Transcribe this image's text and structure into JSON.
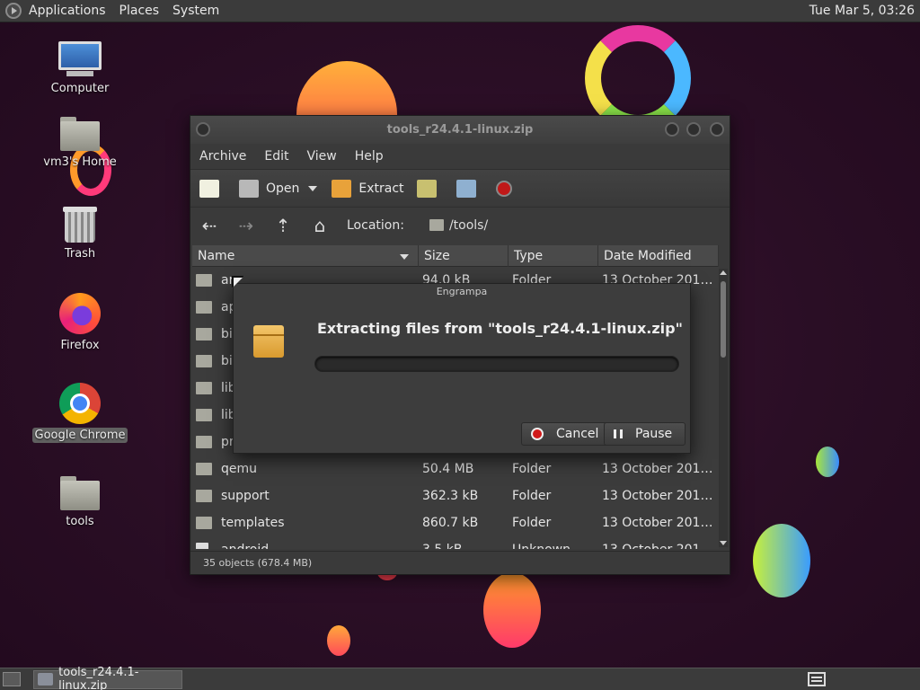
{
  "panel": {
    "menus": [
      "Applications",
      "Places",
      "System"
    ],
    "clock": "Tue Mar  5, 03:26"
  },
  "desktop": {
    "icons": [
      {
        "label": "Computer",
        "icon": "computer-icon"
      },
      {
        "label": "vm3's Home",
        "icon": "home-folder-icon"
      },
      {
        "label": "Trash",
        "icon": "trash-icon"
      },
      {
        "label": "Firefox",
        "icon": "firefox-icon"
      },
      {
        "label": "Google Chrome",
        "icon": "chrome-icon"
      },
      {
        "label": "tools",
        "icon": "folder-icon"
      }
    ]
  },
  "window": {
    "title": "tools_r24.4.1-linux.zip",
    "menu": [
      "Archive",
      "Edit",
      "View",
      "Help"
    ],
    "toolbar": {
      "open": "Open",
      "extract": "Extract"
    },
    "location_label": "Location:",
    "location": "/tools/",
    "columns": [
      "Name",
      "Size",
      "Type",
      "Date Modified"
    ],
    "rows": [
      {
        "name": "ar",
        "size": "94.0 kB",
        "type": "Folder",
        "date": "13 October 2015, 1..."
      },
      {
        "name": "ap",
        "size": "",
        "type": "",
        "date": "1..."
      },
      {
        "name": "bin",
        "size": "",
        "type": "",
        "date": "1..."
      },
      {
        "name": "bin",
        "size": "",
        "type": "",
        "date": "1..."
      },
      {
        "name": "lib",
        "size": "",
        "type": "",
        "date": "1..."
      },
      {
        "name": "lib",
        "size": "",
        "type": "",
        "date": "1..."
      },
      {
        "name": "pro",
        "size": "",
        "type": "",
        "date": "1..."
      },
      {
        "name": "qemu",
        "size": "50.4 MB",
        "type": "Folder",
        "date": "13 October 2015, 1..."
      },
      {
        "name": "support",
        "size": "362.3 kB",
        "type": "Folder",
        "date": "13 October 2015, 1..."
      },
      {
        "name": "templates",
        "size": "860.7 kB",
        "type": "Folder",
        "date": "13 October 2015, 1..."
      },
      {
        "name": "android",
        "size": "3.5 kB",
        "type": "Unknown",
        "date": "13 October 2015, 1..."
      }
    ],
    "status": "35 objects (678.4 MB)"
  },
  "dialog": {
    "title": "Engrampa",
    "message": "Extracting files from \"tools_r24.4.1-linux.zip\"",
    "progress": 0,
    "cancel": "Cancel",
    "pause": "Pause"
  },
  "taskbar": {
    "window_label": "tools_r24.4.1-linux.zip"
  }
}
